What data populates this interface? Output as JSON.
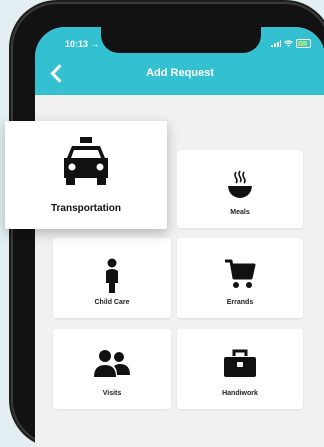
{
  "status_bar": {
    "time": "10:13 →",
    "icons": [
      "signal-icon",
      "wifi-icon",
      "battery-icon"
    ]
  },
  "header": {
    "title": "Add Request",
    "back_icon": "chevron-left-icon",
    "color": "#33c1d1"
  },
  "featured": {
    "label": "Transportation",
    "icon": "taxi-icon"
  },
  "categories": [
    {
      "label": "Meals",
      "icon": "bowl-icon"
    },
    {
      "label": "Child Care",
      "icon": "child-icon"
    },
    {
      "label": "Errands",
      "icon": "shopping-cart-icon"
    },
    {
      "label": "Visits",
      "icon": "people-icon"
    },
    {
      "label": "Handiwork",
      "icon": "toolbox-icon"
    }
  ]
}
